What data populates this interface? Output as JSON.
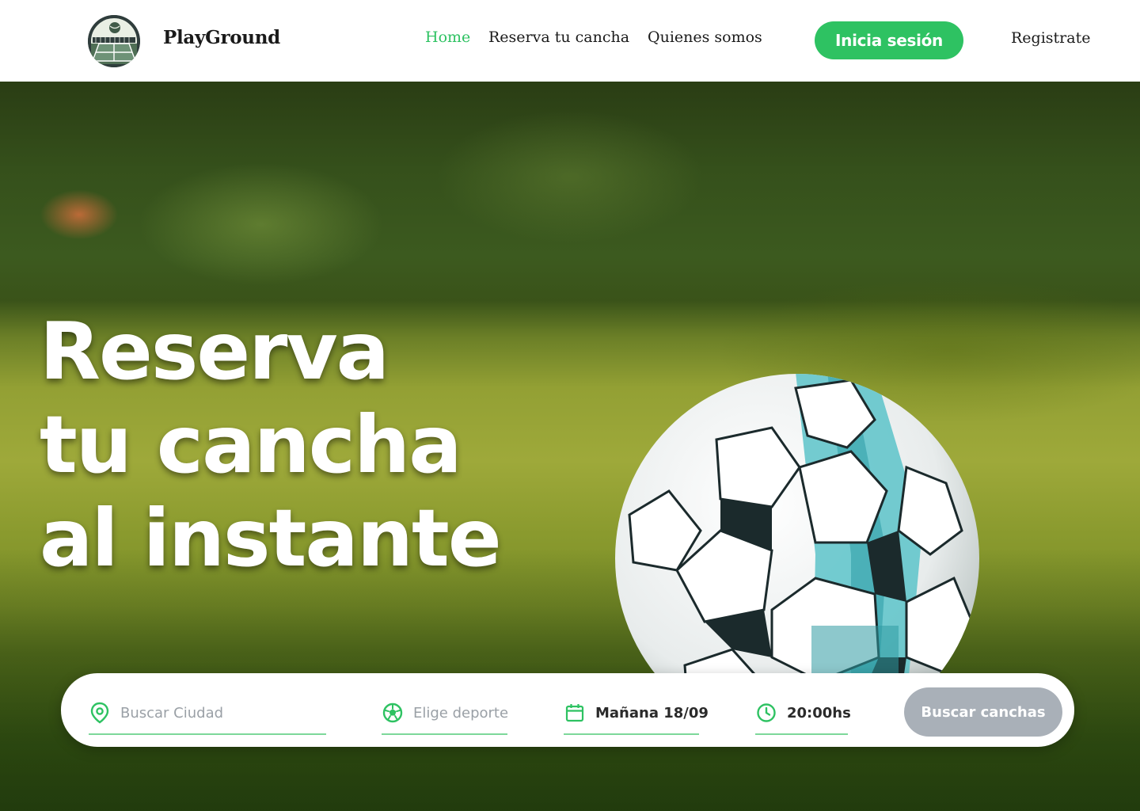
{
  "header": {
    "brand": "PlayGround",
    "logo_icon": "tennis-court-icon",
    "nav": [
      {
        "label": "Home",
        "active": true
      },
      {
        "label": "Reserva tu cancha",
        "active": false
      },
      {
        "label": "Quienes somos",
        "active": false
      }
    ],
    "login_label": "Inicia sesión",
    "register_label": "Registrate"
  },
  "hero": {
    "headline_lines": [
      "Reserva",
      "tu cancha",
      "al instante"
    ],
    "image_subject": "soccer-ball-on-grass"
  },
  "search": {
    "city": {
      "icon": "location-pin-icon",
      "placeholder": "Buscar Ciudad"
    },
    "sport": {
      "icon": "soccer-ball-icon",
      "placeholder": "Elige deporte"
    },
    "date": {
      "icon": "calendar-icon",
      "value": "Mañana 18/09"
    },
    "time": {
      "icon": "clock-icon",
      "value": "20:00hs"
    },
    "button_label": "Buscar canchas"
  },
  "colors": {
    "accent": "#2ec262",
    "disabled_button": "#a9b0b8",
    "nav_text": "#1a1a1a"
  }
}
